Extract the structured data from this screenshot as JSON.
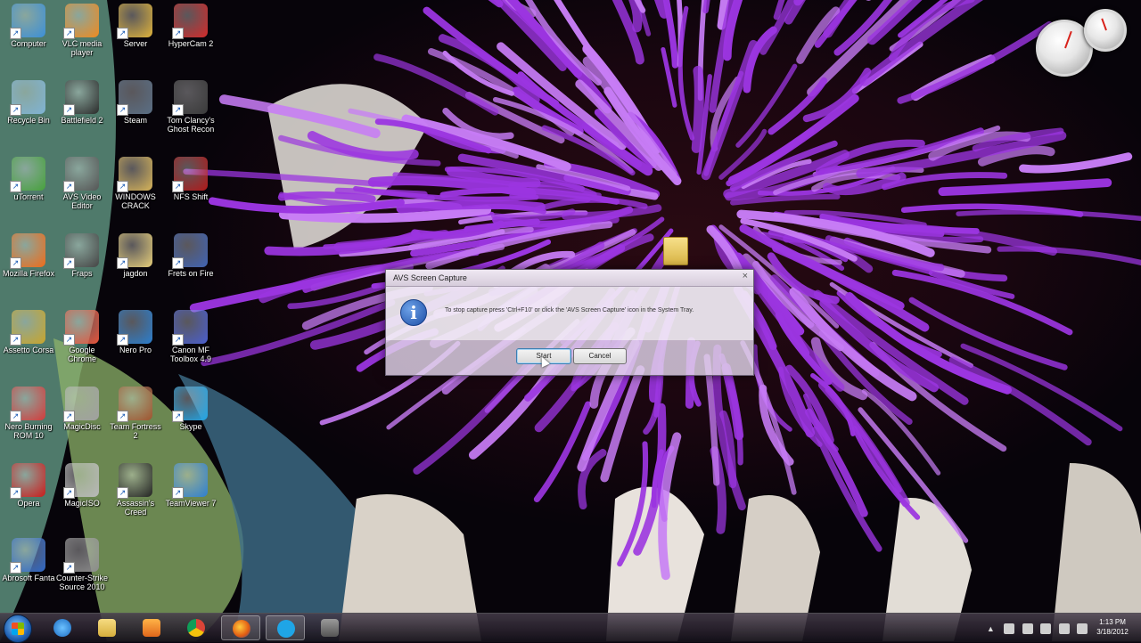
{
  "desktop": {
    "icons": [
      {
        "label": "Computer"
      },
      {
        "label": "VLC media player"
      },
      {
        "label": "Server"
      },
      {
        "label": "HyperCam 2"
      },
      {
        "label": "Recycle Bin"
      },
      {
        "label": "Battlefield 2"
      },
      {
        "label": "Steam"
      },
      {
        "label": "Tom Clancy's Ghost Recon"
      },
      {
        "label": "uTorrent"
      },
      {
        "label": "AVS Video Editor"
      },
      {
        "label": "WINDOWS CRACK"
      },
      {
        "label": "NFS Shift"
      },
      {
        "label": "Mozilla Firefox"
      },
      {
        "label": "Fraps"
      },
      {
        "label": "jagdon"
      },
      {
        "label": "Frets on Fire"
      },
      {
        "label": "Assetto Corsa"
      },
      {
        "label": "Google Chrome"
      },
      {
        "label": "Nero Pro"
      },
      {
        "label": "Canon MF Toolbox 4.9"
      },
      {
        "label": "Nero Burning ROM 10"
      },
      {
        "label": "MagicDisc"
      },
      {
        "label": "Team Fortress 2"
      },
      {
        "label": "Skype"
      },
      {
        "label": "Opera"
      },
      {
        "label": "MagicISO"
      },
      {
        "label": "Assassin's Creed"
      },
      {
        "label": "TeamViewer 7"
      },
      {
        "label": "Abrosoft Fanta"
      },
      {
        "label": "Counter-Strike Source 2010"
      }
    ]
  },
  "dialog": {
    "title": "AVS Screen Capture",
    "close_glyph": "×",
    "message": "To stop capture press 'Ctrl+F10' or click the 'AVS Screen Capture' icon in the System Tray.",
    "info_glyph": "i",
    "start_label": "Start",
    "cancel_label": "Cancel"
  },
  "taskbar": {
    "tray_arrow": "▲",
    "time": "1:13 PM",
    "date": "3/18/2012"
  },
  "colors": {
    "petal_purple": "#9b35e0",
    "petal_tip": "#c77cf5"
  }
}
